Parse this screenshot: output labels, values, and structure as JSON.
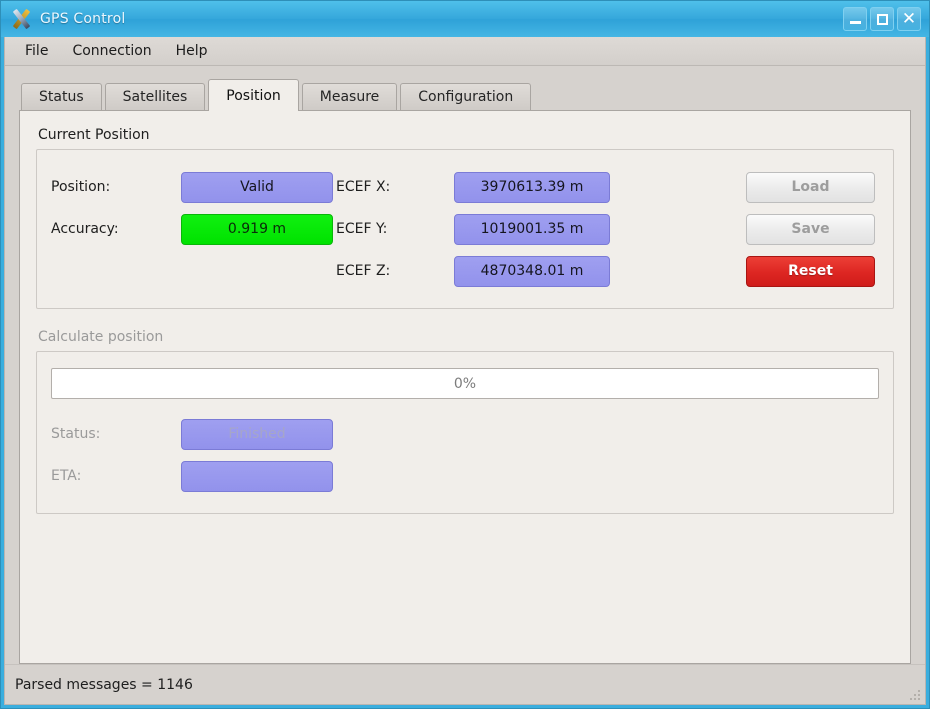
{
  "window": {
    "title": "GPS Control",
    "icon": "gps-crossed-blades-icon",
    "controls": {
      "minimize": "minimize-icon",
      "maximize": "maximize-icon",
      "close": "✕"
    }
  },
  "menubar": {
    "items": [
      {
        "label": "File"
      },
      {
        "label": "Connection"
      },
      {
        "label": "Help"
      }
    ]
  },
  "tabs": [
    {
      "label": "Status",
      "active": false
    },
    {
      "label": "Satellites",
      "active": false
    },
    {
      "label": "Position",
      "active": true
    },
    {
      "label": "Measure",
      "active": false
    },
    {
      "label": "Configuration",
      "active": false
    }
  ],
  "current_position": {
    "group_title": "Current Position",
    "position_label": "Position:",
    "position_value": "Valid",
    "accuracy_label": "Accuracy:",
    "accuracy_value": "0.919 m",
    "ecef_x_label": "ECEF X:",
    "ecef_x_value": "3970613.39 m",
    "ecef_y_label": "ECEF Y:",
    "ecef_y_value": "1019001.35 m",
    "ecef_z_label": "ECEF Z:",
    "ecef_z_value": "4870348.01 m",
    "load_button": "Load",
    "save_button": "Save",
    "reset_button": "Reset"
  },
  "calculate_position": {
    "group_title": "Calculate position",
    "progress_text": "0%",
    "progress_percent": 0,
    "status_label": "Status:",
    "status_value": "Finished",
    "eta_label": "ETA:",
    "eta_value": ""
  },
  "statusbar": {
    "text": "Parsed messages = 1146"
  },
  "colors": {
    "titlebar": "#36a8dc",
    "window_frame": "#3aaede",
    "chrome": "#d6d2ce",
    "panel": "#f1eeea",
    "field_purple": "#9292ec",
    "field_green": "#00e200",
    "danger": "#dd2622",
    "disabled_text": "#9a9a9a"
  }
}
